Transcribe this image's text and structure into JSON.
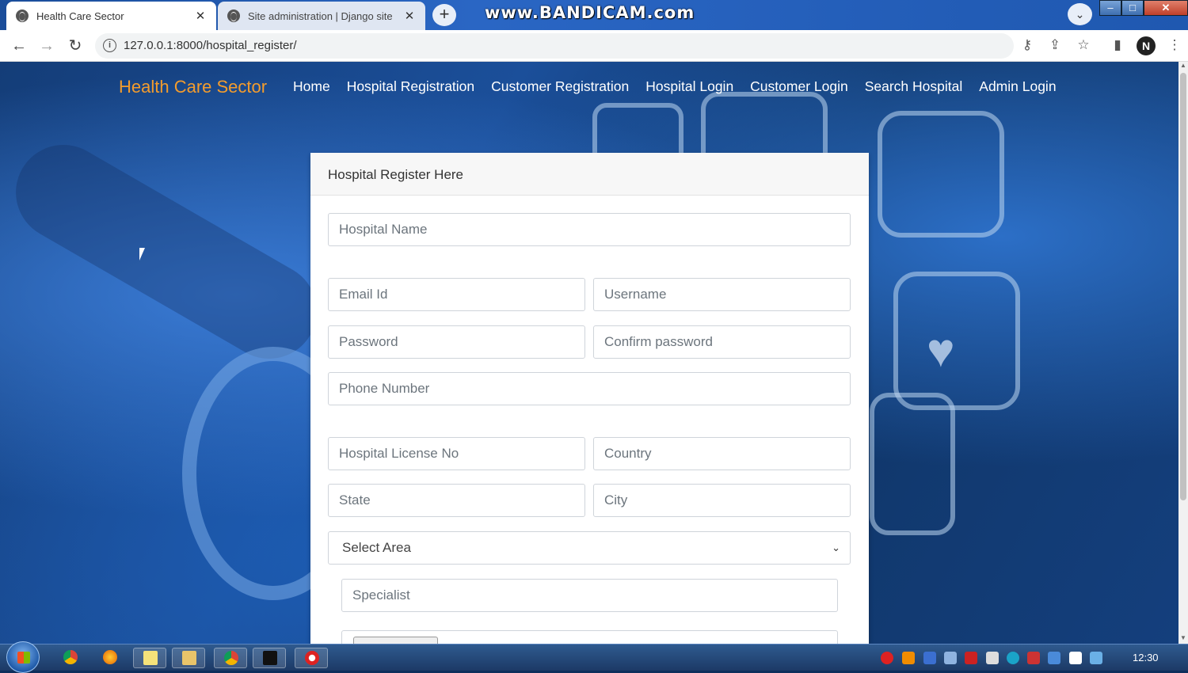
{
  "browser": {
    "tabs": [
      {
        "title": "Health Care Sector",
        "close": "✕",
        "active": true
      },
      {
        "title": "Site administration | Django site",
        "close": "✕",
        "active": false
      }
    ],
    "new_tab": "+",
    "watermark": "www.BANDICAM.com",
    "url": "127.0.0.1:8000/hospital_register/",
    "tab_search_icon": "⌄"
  },
  "site": {
    "brand": "Health Care Sector",
    "nav": [
      "Home",
      "Hospital Registration",
      "Customer Registration",
      "Hospital Login",
      "Customer Login",
      "Search Hospital",
      "Admin Login"
    ]
  },
  "form": {
    "title": "Hospital Register Here",
    "placeholders": {
      "hospital_name": "Hospital Name",
      "email": "Email Id",
      "username": "Username",
      "password": "Password",
      "confirm_password": "Confirm password",
      "phone": "Phone Number",
      "license": "Hospital License No",
      "country": "Country",
      "state": "State",
      "city": "City",
      "area": "Select Area",
      "specialist": "Specialist"
    }
  },
  "taskbar": {
    "clock": "12:30"
  },
  "colors": {
    "brand": "#f39c2d",
    "background_blue": "#1b4f9a",
    "card": "#ffffff"
  }
}
